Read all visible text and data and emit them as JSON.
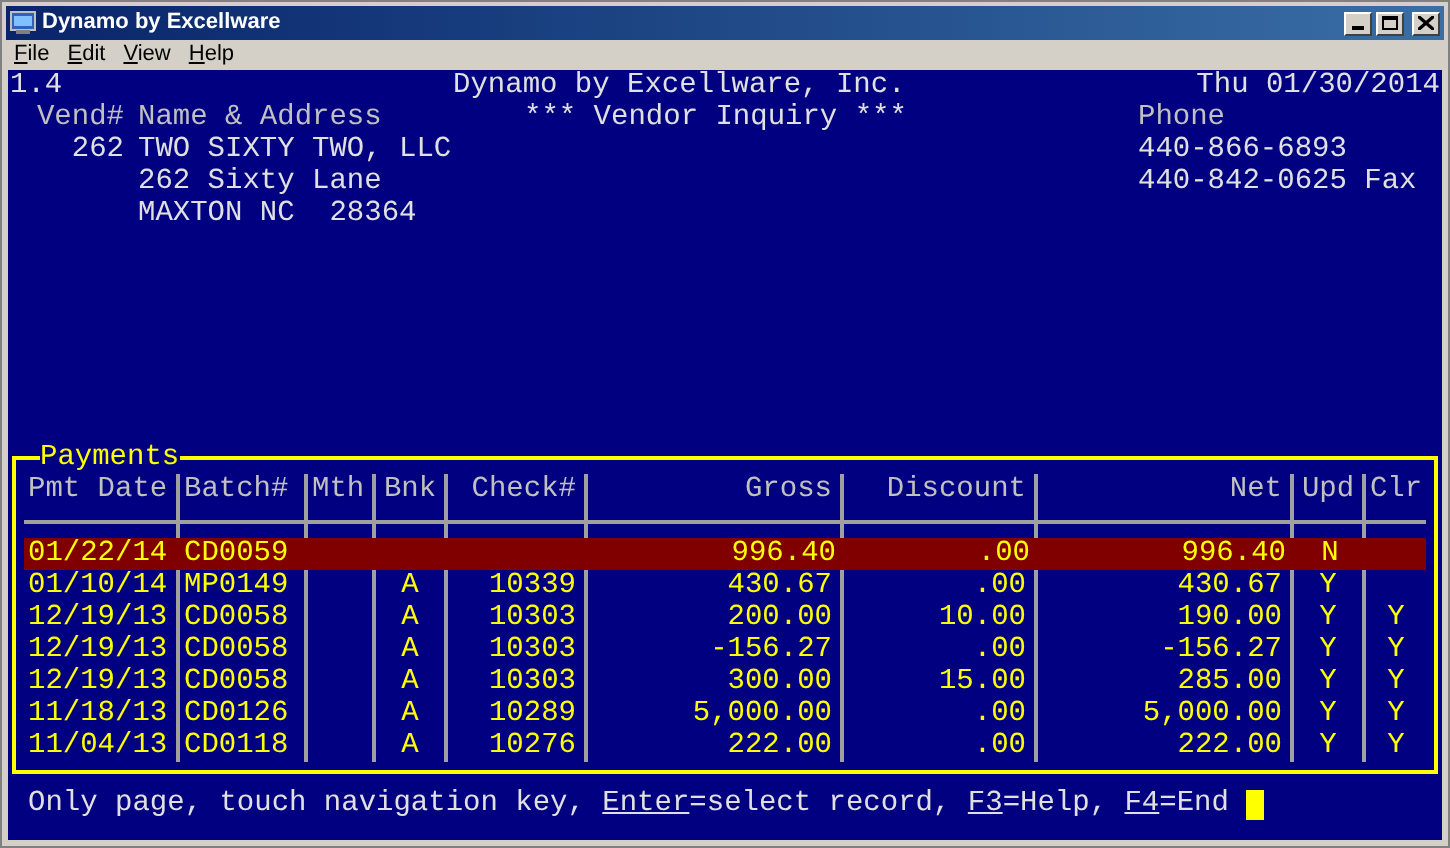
{
  "window": {
    "title": "Dynamo by Excellware"
  },
  "menu": [
    "File",
    "Edit",
    "View",
    "Help"
  ],
  "screen": {
    "version": "1.4",
    "company": "Dynamo by Excellware, Inc.",
    "date": "Thu 01/30/2014",
    "screen_title": "*** Vendor Inquiry ***",
    "vendor_label": "Vend#",
    "name_label": "Name & Address",
    "phone_label": "Phone",
    "vendor": {
      "number": "262",
      "name": "TWO SIXTY TWO, LLC",
      "address_lines": [
        "262 Sixty Lane",
        "MAXTON NC  28364"
      ],
      "phones": [
        "440-866-6893",
        "440-842-0625 Fax"
      ]
    }
  },
  "payments": {
    "title": "Payments",
    "columns": [
      "Pmt Date",
      "Batch#",
      "Mth",
      "Bnk",
      "Check#",
      "Gross",
      "Discount",
      "Net",
      "Upd",
      "Clr"
    ],
    "rows": [
      {
        "selected": true,
        "cells": [
          "01/22/14",
          "CD0059",
          null,
          null,
          null,
          "996.40",
          ".00",
          "996.40",
          "N",
          null
        ]
      },
      {
        "selected": false,
        "cells": [
          "01/10/14",
          "MP0149",
          null,
          "A",
          "10339",
          "430.67",
          ".00",
          "430.67",
          "Y",
          null
        ]
      },
      {
        "selected": false,
        "cells": [
          "12/19/13",
          "CD0058",
          null,
          "A",
          "10303",
          "200.00",
          "10.00",
          "190.00",
          "Y",
          "Y"
        ]
      },
      {
        "selected": false,
        "cells": [
          "12/19/13",
          "CD0058",
          null,
          "A",
          "10303",
          "-156.27",
          ".00",
          "-156.27",
          "Y",
          "Y"
        ]
      },
      {
        "selected": false,
        "cells": [
          "12/19/13",
          "CD0058",
          null,
          "A",
          "10303",
          "300.00",
          "15.00",
          "285.00",
          "Y",
          "Y"
        ]
      },
      {
        "selected": false,
        "cells": [
          "11/18/13",
          "CD0126",
          null,
          "A",
          "10289",
          "5,000.00",
          ".00",
          "5,000.00",
          "Y",
          "Y"
        ]
      },
      {
        "selected": false,
        "cells": [
          "11/04/13",
          "CD0118",
          null,
          "A",
          "10276",
          "222.00",
          ".00",
          "222.00",
          "Y",
          "Y"
        ]
      }
    ]
  },
  "status_line": [
    {
      "text": "Only page, touch navigation key, ",
      "underlined": false
    },
    {
      "text": "Enter",
      "underlined": true
    },
    {
      "text": "=select record, ",
      "underlined": false
    },
    {
      "text": "F3",
      "underlined": true
    },
    {
      "text": "=Help, ",
      "underlined": false
    },
    {
      "text": "F4",
      "underlined": true
    },
    {
      "text": "=End",
      "underlined": false
    }
  ]
}
